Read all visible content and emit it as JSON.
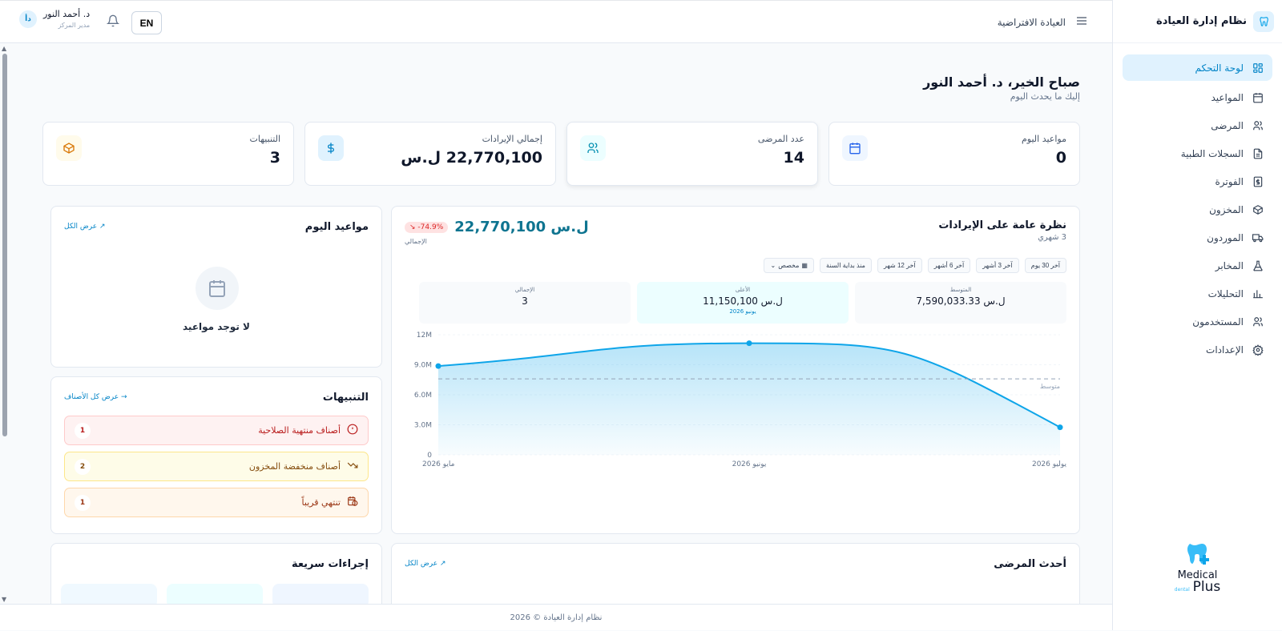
{
  "sidebar": {
    "brand_title": "نظام إدارة العيادة",
    "items": [
      {
        "label": "لوحة التحكم",
        "icon": "dashboard-icon"
      },
      {
        "label": "المواعيد",
        "icon": "calendar-icon"
      },
      {
        "label": "المرضى",
        "icon": "users-icon"
      },
      {
        "label": "السجلات الطبية",
        "icon": "file-icon"
      },
      {
        "label": "الفوترة",
        "icon": "invoice-icon"
      },
      {
        "label": "المخزون",
        "icon": "box-icon"
      },
      {
        "label": "الموردون",
        "icon": "truck-icon"
      },
      {
        "label": "المخابر",
        "icon": "flask-icon"
      },
      {
        "label": "التحليلات",
        "icon": "bar-chart-icon"
      },
      {
        "label": "المستخدمون",
        "icon": "users-icon"
      },
      {
        "label": "الإعدادات",
        "icon": "gear-icon"
      }
    ],
    "logo_line1": "Medical",
    "logo_line2": "Plus",
    "logo_sub": "dental"
  },
  "header": {
    "clinic_name": "العيادة الافتراضية",
    "lang": "EN",
    "user_name": "د. أحمد النور",
    "user_role": "مدير المركز",
    "avatar_initials": "دأ"
  },
  "greeting": {
    "title": "صباح الخير، د. أحمد النور",
    "subtitle": "إليك ما يحدث اليوم"
  },
  "stats": [
    {
      "label": "مواعيد اليوم",
      "value": "0",
      "icon": "calendar-icon",
      "color": "#2563eb"
    },
    {
      "label": "عدد المرضى",
      "value": "14",
      "icon": "users-icon",
      "color": "#0891b2"
    },
    {
      "label": "إجمالي الإيرادات",
      "value": "22,770,100 ل.س",
      "icon": "dollar-icon",
      "color": "#0284c7"
    },
    {
      "label": "التنبيهات",
      "value": "3",
      "icon": "box-icon",
      "color": "#d97706"
    }
  ],
  "revenue": {
    "title": "نظرة عامة على الإيرادات",
    "subtitle": "3 شهري",
    "total": "ل.س 22,770,100",
    "total_label": "الإجمالي",
    "change": "-74.9%",
    "filters": [
      "آخر 30 يوم",
      "آخر 3 أشهر",
      "آخر 6 أشهر",
      "آخر 12 شهر",
      "منذ بداية السنة",
      "مخصص"
    ],
    "avg_label": "المتوسط",
    "avg_value": "ل.س 7,590,033.33",
    "high_label": "الأعلى",
    "high_value": "ل.س 11,150,100",
    "high_period": "يونيو 2026",
    "count_label": "الإجمالي",
    "count_value": "3",
    "avg_line_label": "متوسط"
  },
  "chart_data": {
    "type": "area",
    "categories": [
      "مايو 2026",
      "يونيو 2026",
      "يوليو 2026"
    ],
    "values": [
      8870000,
      11150100,
      2750000
    ],
    "average": 7590033.33,
    "yticks": [
      "0",
      "3.0M",
      "6.0M",
      "9.0M",
      "12M"
    ],
    "ylim": [
      0,
      12000000
    ],
    "color": "#0ea5e9"
  },
  "appointments": {
    "title": "مواعيد اليوم",
    "view_all": "عرض الكل",
    "empty": "لا توجد مواعيد"
  },
  "alerts": {
    "title": "التنبيهات",
    "view_all": "عرض كل الأصناف",
    "items": [
      {
        "label": "أصناف منتهية الصلاحية",
        "count": "1"
      },
      {
        "label": "أصناف منخفضة المخزون",
        "count": "2"
      },
      {
        "label": "تنتهي قريباً",
        "count": "1"
      }
    ]
  },
  "recent_patients": {
    "title": "أحدث المرضى",
    "view_all": "عرض الكل"
  },
  "quick_actions": {
    "title": "إجراءات سريعة"
  },
  "footer": {
    "text": "نظام إدارة العيادة © 2026"
  }
}
